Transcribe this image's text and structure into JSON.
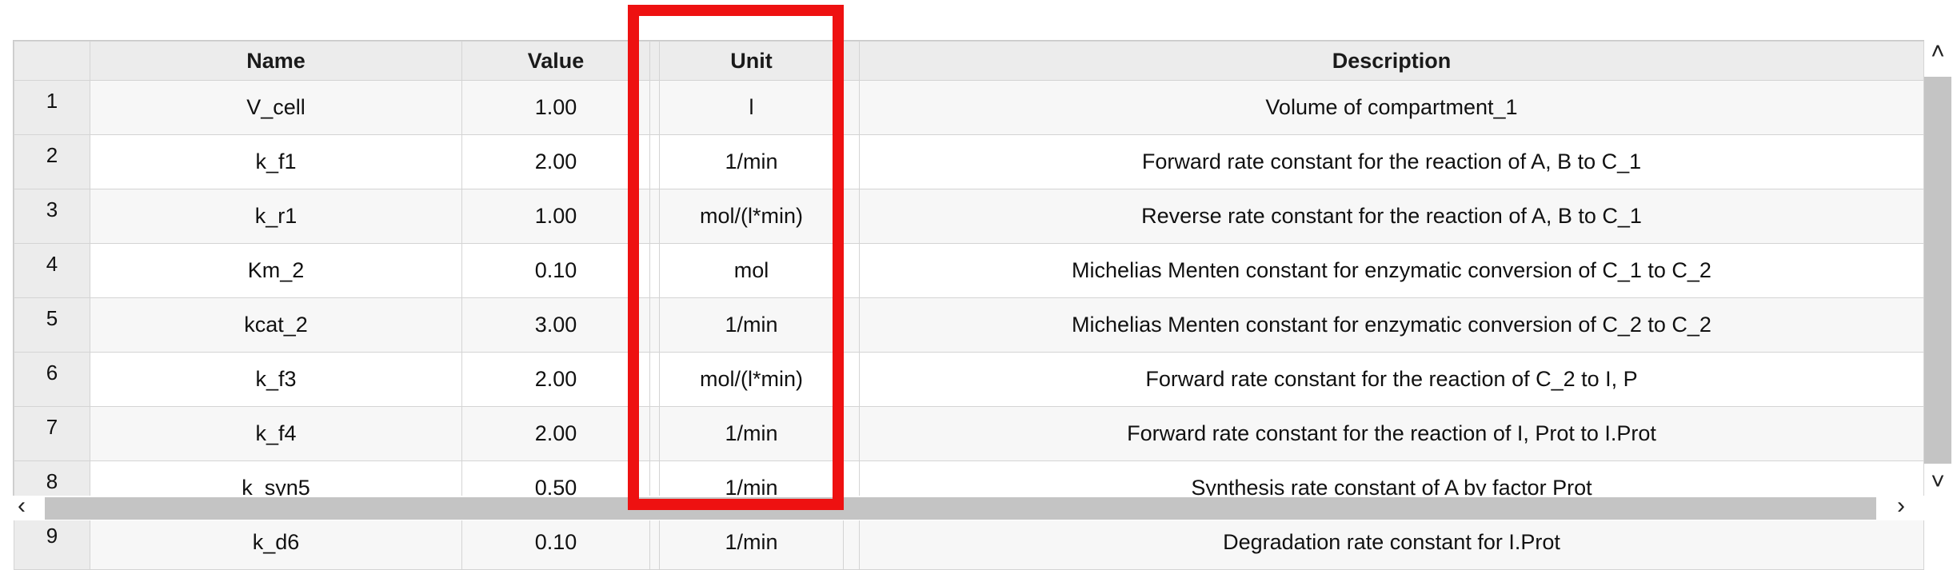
{
  "table": {
    "columns": [
      "",
      "Name",
      "Value",
      "Unit",
      "",
      "Description"
    ],
    "rows": [
      {
        "num": "1",
        "name": "V_cell",
        "value": "1.00",
        "unit": "l",
        "description": "Volume of compartment_1"
      },
      {
        "num": "2",
        "name": "k_f1",
        "value": "2.00",
        "unit": "1/min",
        "description": "Forward rate constant for the reaction of A, B to C_1"
      },
      {
        "num": "3",
        "name": "k_r1",
        "value": "1.00",
        "unit": "mol/(l*min)",
        "description": "Reverse rate constant for the reaction of A, B to C_1"
      },
      {
        "num": "4",
        "name": "Km_2",
        "value": "0.10",
        "unit": "mol",
        "description": "Michelias Menten constant for enzymatic conversion of C_1 to C_2"
      },
      {
        "num": "5",
        "name": "kcat_2",
        "value": "3.00",
        "unit": "1/min",
        "description": "Michelias Menten constant for enzymatic conversion of C_2 to C_2"
      },
      {
        "num": "6",
        "name": "k_f3",
        "value": "2.00",
        "unit": "mol/(l*min)",
        "description": "Forward rate constant for the reaction of C_2 to I, P"
      },
      {
        "num": "7",
        "name": "k_f4",
        "value": "2.00",
        "unit": "1/min",
        "description": "Forward rate constant for the reaction of I, Prot to I.Prot"
      },
      {
        "num": "8",
        "name": "k_syn5",
        "value": "0.50",
        "unit": "1/min",
        "description": "Synthesis rate constant of A by factor Prot"
      },
      {
        "num": "9",
        "name": "k_d6",
        "value": "0.10",
        "unit": "1/min",
        "description": "Degradation rate constant for I.Prot"
      }
    ]
  },
  "scrollbars": {
    "up_icon": "˄",
    "down_icon": "˅",
    "left_icon": "‹",
    "right_icon": "›"
  },
  "highlight": {
    "column": "Unit",
    "color": "#ee1111"
  }
}
